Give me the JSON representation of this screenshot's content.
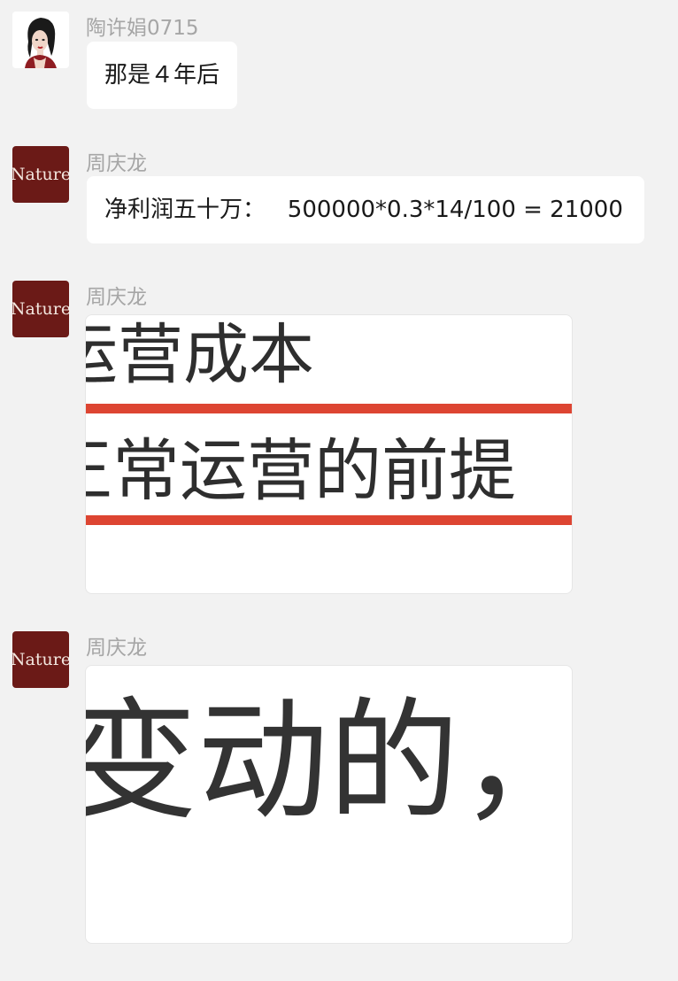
{
  "messages": [
    {
      "sender": "陶许娟0715",
      "text": "那是４年后"
    },
    {
      "sender": "周庆龙",
      "avatar_label": "Nature",
      "text": "净利润五十万：   500000*0.3*14/100 = 21000"
    },
    {
      "sender": "周庆龙",
      "avatar_label": "Nature",
      "image_lines": [
        "运营成本",
        "正常运营的前提"
      ]
    },
    {
      "sender": "周庆龙",
      "avatar_label": "Nature",
      "image_lines": [
        "变动的，"
      ]
    }
  ],
  "colors": {
    "background": "#f2f2f2",
    "bubble": "#ffffff",
    "sender_name": "#a6a6a6",
    "nature_avatar": "#6b1a17",
    "red_rule": "#dd4532"
  }
}
